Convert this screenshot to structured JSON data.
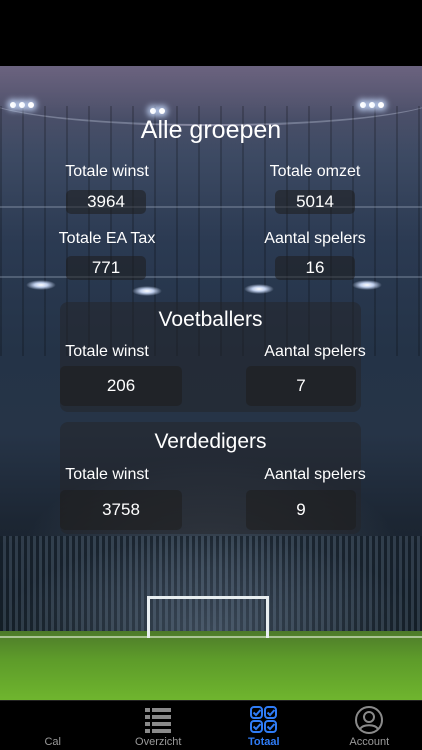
{
  "summary": {
    "title": "Alle groepen",
    "total_profit_label": "Totale winst",
    "total_profit": "3964",
    "total_revenue_label": "Totale omzet",
    "total_revenue": "5014",
    "ea_tax_label": "Totale EA Tax",
    "ea_tax": "771",
    "player_count_label": "Aantal spelers",
    "player_count": "16"
  },
  "groups": [
    {
      "name": "Voetballers",
      "profit_label": "Totale winst",
      "profit": "206",
      "players_label": "Aantal spelers",
      "players": "7"
    },
    {
      "name": "Verdedigers",
      "profit_label": "Totale winst",
      "profit": "3758",
      "players_label": "Aantal spelers",
      "players": "9"
    }
  ],
  "tabbar": {
    "active": "Totaal",
    "items": [
      {
        "label": "Cal",
        "icon": "calendar-icon"
      },
      {
        "label": "Overzicht",
        "icon": "list-icon"
      },
      {
        "label": "Totaal",
        "icon": "checklist-icon"
      },
      {
        "label": "Account",
        "icon": "account-icon"
      }
    ]
  },
  "colors": {
    "accent": "#2f7cf6",
    "inactive_tab": "#9a9a9a"
  }
}
